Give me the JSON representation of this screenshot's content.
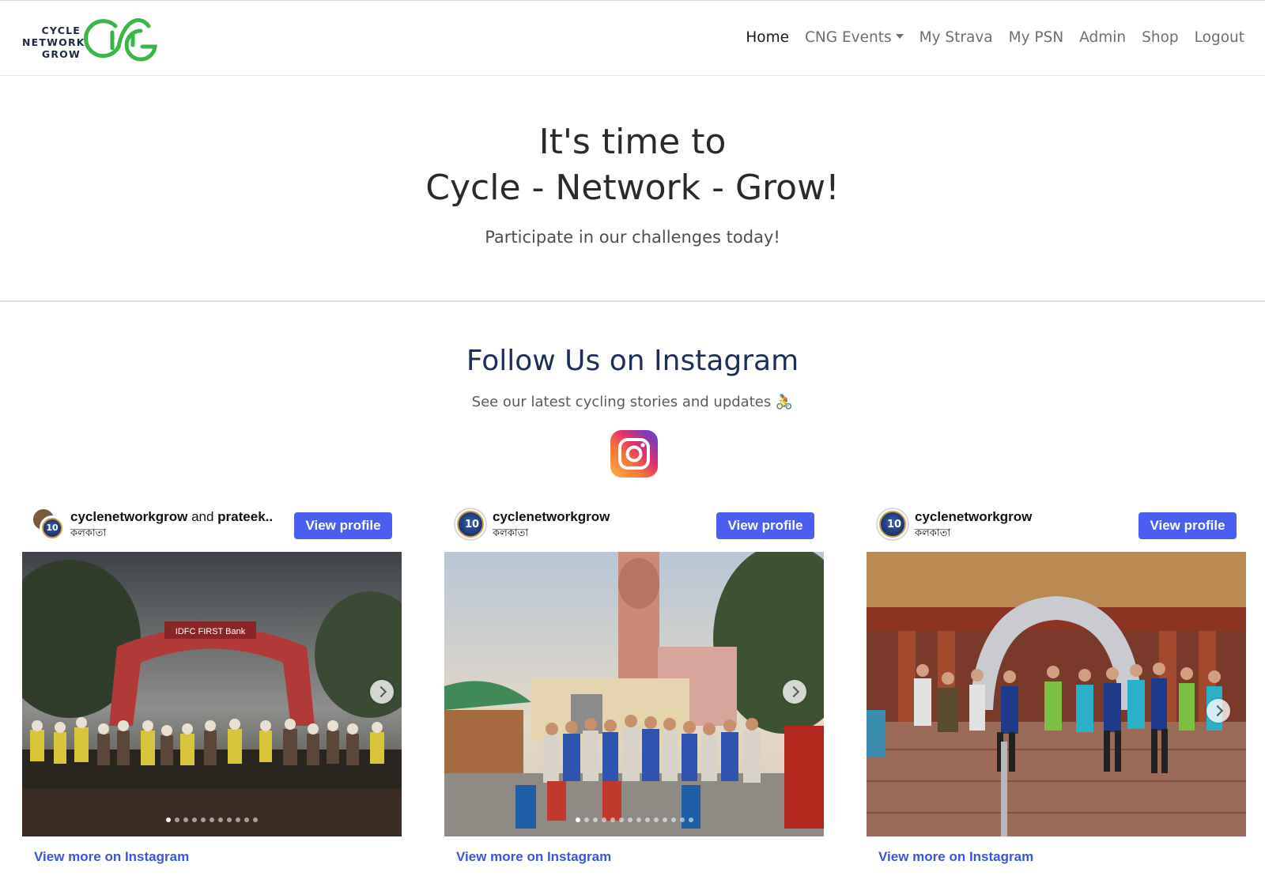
{
  "brand": {
    "line1": "CYCLE",
    "line2": "NETWORK",
    "line3": "GROW",
    "logo_color": "#3bb54a",
    "text_color": "#1d2a44"
  },
  "nav": {
    "home": "Home",
    "events": "CNG Events",
    "strava": "My Strava",
    "psn": "My PSN",
    "admin": "Admin",
    "shop": "Shop",
    "logout": "Logout"
  },
  "hero": {
    "line1": "It's time to",
    "line2": "Cycle - Network - Grow!",
    "subtitle": "Participate in our challenges today!"
  },
  "instagram": {
    "heading": "Follow Us on Instagram",
    "subtitle": "See our latest cycling stories and updates 🚴",
    "icon": "instagram-icon",
    "button_color": "#4a5ef0",
    "posts": [
      {
        "account": "cyclenetworkgrow",
        "and_text": "and",
        "coauthor": "prateek..",
        "location": "কলকাতা",
        "avatar_text": "10",
        "view_profile": "View profile",
        "view_more": "View more on Instagram",
        "dots_total": 11,
        "dot_active": 1
      },
      {
        "account": "cyclenetworkgrow",
        "location": "কলকাতা",
        "avatar_text": "10",
        "view_profile": "View profile",
        "view_more": "View more on Instagram",
        "dots_total": 14,
        "dot_active": 1
      },
      {
        "account": "cyclenetworkgrow",
        "location": "কলকাতা",
        "avatar_text": "10",
        "view_profile": "View profile",
        "view_more": "View more on Instagram"
      }
    ]
  }
}
